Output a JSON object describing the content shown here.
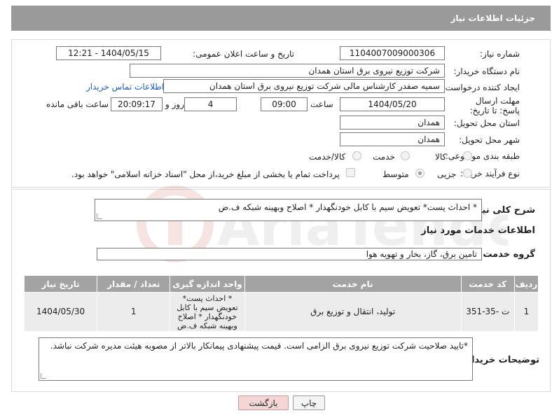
{
  "header": {
    "title": "جزئیات اطلاعات نیاز"
  },
  "form": {
    "need_number": {
      "label": "شماره نیاز:",
      "value": "1104007009000306"
    },
    "announce_datetime": {
      "label": "تاریخ و ساعت اعلان عمومی:",
      "value": "1404/05/15 - 12:21"
    },
    "buyer_org": {
      "label": "نام دستگاه خریدار:",
      "value": "شرکت توزیع نیروی برق استان همدان"
    },
    "requester": {
      "label": "ایجاد کننده درخواست:",
      "value": "سمیه صفدر کارشناس مالی شرکت توزیع نیروی برق استان همدان",
      "contact_link": "اطلاعات تماس خریدار"
    },
    "deadline": {
      "label": "مهلت ارسال پاسخ: تا تاریخ:",
      "date": "1404/05/20",
      "time_label": "ساعت",
      "time": "09:00",
      "days": "4",
      "days_label": "روز و",
      "remaining": "20:09:17",
      "remaining_label": "ساعت باقی مانده"
    },
    "province": {
      "label": "استان محل تحویل:",
      "value": "همدان"
    },
    "city": {
      "label": "شهر محل تحویل:",
      "value": "همدان"
    },
    "category": {
      "label": "طبقه بندی موضوعی:",
      "options": [
        "کالا",
        "خدمت",
        "کالا/خدمت"
      ]
    },
    "purchase_type": {
      "label": "نوع فرآیند خرید :",
      "options": [
        "جزیی",
        "متوسط"
      ],
      "payment_note": "پرداخت تمام یا بخشی از مبلغ خرید،از محل \"اسناد خزانه اسلامی\" خواهد بود."
    }
  },
  "description": {
    "label": "شرح کلی نیاز:",
    "value": "* احداث پست* تعویض سیم با کابل خودنگهدار * اصلاح وبهینه شبکه ف.ض"
  },
  "services_title": "اطلاعات خدمات مورد نیاز",
  "service_group": {
    "label": "گروه خدمت:",
    "value": "تامین برق، گاز، بخار و تهویه هوا"
  },
  "table": {
    "headers": [
      "ردیف",
      "کد خدمت",
      "نام خدمت",
      "واحد اندازه گیری",
      "تعداد / مقدار",
      "تاریخ نیاز"
    ],
    "rows": [
      {
        "index": "1",
        "code": "ت -35-351",
        "name": "تولید، انتقال و توزیع برق",
        "unit": "* احداث پست* تعویض سیم با کابل خودنگهدار * اصلاح وبهینه شبکه ف.ض",
        "qty": "1",
        "date": "1404/05/30"
      }
    ]
  },
  "buyer_notes": {
    "label": "توضیحات خریدار:",
    "value": "*تایید صلاحیت شرکت توزیع نیروی برق الزامی است. قیمت پیشنهادی پیمانکار بالاتر از مصوبه هیئت مدیره شرکت نباشد."
  },
  "buttons": {
    "print": "چاپ",
    "back": "بازگشت"
  },
  "watermark_text": "AriaTender.neT",
  "colors": {
    "header_bg": "#9a9a9a",
    "link": "#1a5dbf",
    "back_button_bg": "#f5d6d6"
  }
}
